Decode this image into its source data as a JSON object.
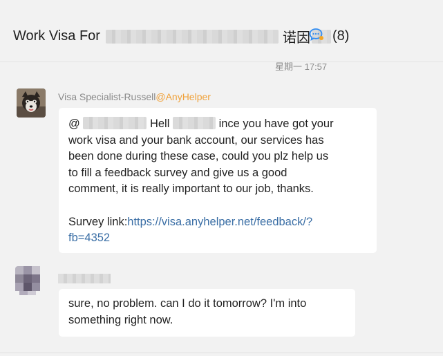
{
  "header": {
    "title_prefix": "Work Visa For",
    "title_suffix": "诺因",
    "member_count": "(8)",
    "chat_icon": "group-chat-bubble-icon"
  },
  "conversation": {
    "timestamp": "星期一 17:57",
    "messages": [
      {
        "sender": "Visa Specialist-Russell",
        "mention": "@AnyHelper",
        "line1_start": "@",
        "line1_mid": "Hell",
        "line1_end": "ince you have got your",
        "line2": "work visa and your bank account, our services has",
        "line3": "been done during these case, could you plz help us",
        "line4": "to fill a feedback survey and give us a good",
        "line5": "comment, it is really important to our job, thanks.",
        "survey_label": "Survey link:",
        "survey_url_part1": "https://visa.anyhelper.net/feedback/?",
        "survey_url_part2": "fb=4352"
      },
      {
        "line1": "sure, no problem. can I do it tomorrow? I'm into",
        "line2": "something right now."
      }
    ]
  },
  "colors": {
    "background": "#f2f2f2",
    "bubble": "#ffffff",
    "mention": "#f0a23b",
    "link": "#3a6ea5",
    "chat_icon": "#2f8cf2"
  }
}
